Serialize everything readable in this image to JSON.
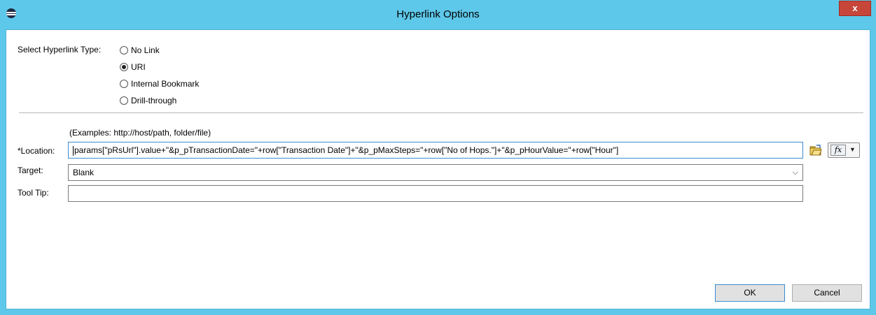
{
  "window": {
    "title": "Hyperlink Options",
    "close_label": "x"
  },
  "hyperlink_type": {
    "label": "Select Hyperlink Type:",
    "options": [
      {
        "label": "No Link",
        "checked": false
      },
      {
        "label": "URI",
        "checked": true
      },
      {
        "label": "Internal Bookmark",
        "checked": false
      },
      {
        "label": "Drill-through",
        "checked": false
      }
    ]
  },
  "uri": {
    "examples": "(Examples: http://host/path, folder/file)",
    "location_label": "*Location:",
    "location_value": "params[\"pRsUrl\"].value+\"&p_pTransactionDate=\"+row[\"Transaction Date\"]+\"&p_pMaxSteps=\"+row[\"No of Hops.\"]+\"&p_pHourValue=\"+row[\"Hour\"]",
    "target_label": "Target:",
    "target_value": "Blank",
    "tooltip_label": "Tool Tip:",
    "tooltip_value": "",
    "browse_icon": "folder-open-icon",
    "expression_icon": "fx-icon"
  },
  "buttons": {
    "ok": "OK",
    "cancel": "Cancel"
  },
  "colors": {
    "titlebar": "#5ec8ea",
    "close_button": "#c7463a"
  }
}
